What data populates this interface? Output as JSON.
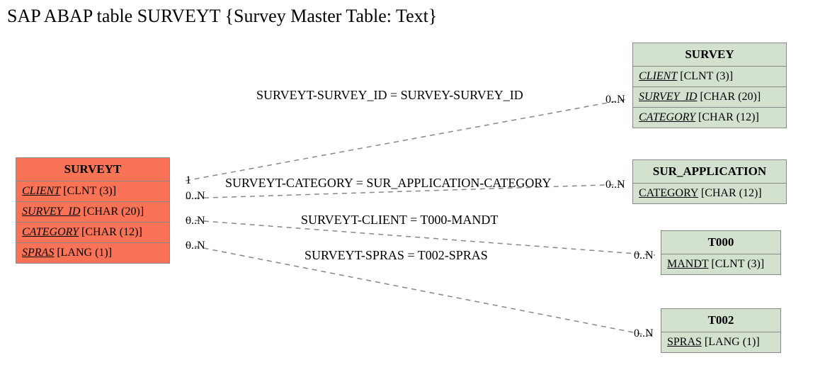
{
  "title": "SAP ABAP table SURVEYT {Survey Master Table: Text}",
  "entities": {
    "surveyt": {
      "name": "SURVEYT",
      "fields": [
        {
          "name": "CLIENT",
          "type": "[CLNT (3)]"
        },
        {
          "name": "SURVEY_ID",
          "type": "[CHAR (20)]"
        },
        {
          "name": "CATEGORY",
          "type": "[CHAR (12)]"
        },
        {
          "name": "SPRAS",
          "type": "[LANG (1)]"
        }
      ]
    },
    "survey": {
      "name": "SURVEY",
      "fields": [
        {
          "name": "CLIENT",
          "type": "[CLNT (3)]"
        },
        {
          "name": "SURVEY_ID",
          "type": "[CHAR (20)]"
        },
        {
          "name": "CATEGORY",
          "type": "[CHAR (12)]"
        }
      ]
    },
    "sur_application": {
      "name": "SUR_APPLICATION",
      "fields": [
        {
          "name": "CATEGORY",
          "type": "[CHAR (12)]"
        }
      ]
    },
    "t000": {
      "name": "T000",
      "fields": [
        {
          "name": "MANDT",
          "type": "[CLNT (3)]"
        }
      ]
    },
    "t002": {
      "name": "T002",
      "fields": [
        {
          "name": "SPRAS",
          "type": "[LANG (1)]"
        }
      ]
    }
  },
  "relations": [
    {
      "label": "SURVEYT-SURVEY_ID = SURVEY-SURVEY_ID",
      "left_card": "1",
      "right_card": "0..N"
    },
    {
      "label": "SURVEYT-CATEGORY = SUR_APPLICATION-CATEGORY",
      "left_card": "0..N",
      "right_card": "0..N"
    },
    {
      "label": "SURVEYT-CLIENT = T000-MANDT",
      "left_card": "0..N",
      "right_card": "0..N"
    },
    {
      "label": "SURVEYT-SPRAS = T002-SPRAS",
      "left_card": "0..N",
      "right_card": "0..N"
    }
  ]
}
